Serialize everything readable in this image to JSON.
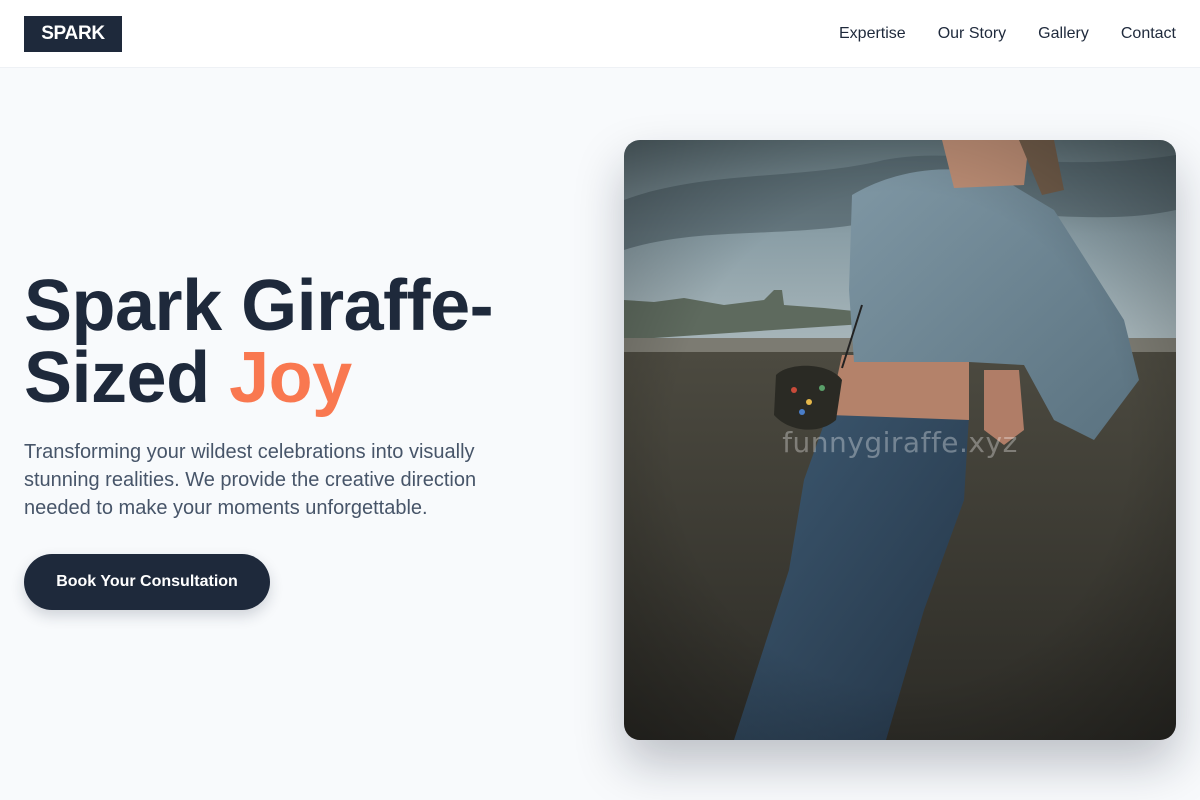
{
  "header": {
    "logo_text": "SPARK",
    "nav": [
      {
        "label": "Expertise"
      },
      {
        "label": "Our Story"
      },
      {
        "label": "Gallery"
      },
      {
        "label": "Contact"
      }
    ]
  },
  "hero": {
    "title_line1": "Spark Giraffe-",
    "title_line2": "Sized",
    "title_accent": "Joy",
    "subtitle": "Transforming your wildest celebrations into visually stunning realities. We provide the creative direction needed to make your moments unforgettable.",
    "cta_label": "Book Your Consultation",
    "image_watermark": "funnygiraffe.xyz"
  },
  "colors": {
    "primary": "#1e293b",
    "accent": "#f97850",
    "background": "#f8fafc",
    "body_text": "#475569"
  }
}
